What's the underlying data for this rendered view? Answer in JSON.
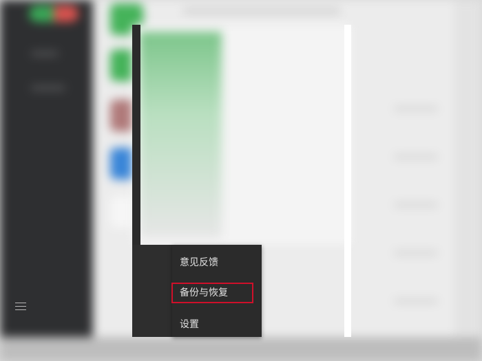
{
  "menu": {
    "items": [
      {
        "label": "意见反馈"
      },
      {
        "label": "备份与恢复",
        "highlighted": true
      },
      {
        "label": "设置"
      }
    ]
  },
  "colors": {
    "highlight_border": "#d0102a",
    "menu_background": "#2b2b2b"
  },
  "icons": {
    "menu": "hamburger-menu-icon"
  }
}
